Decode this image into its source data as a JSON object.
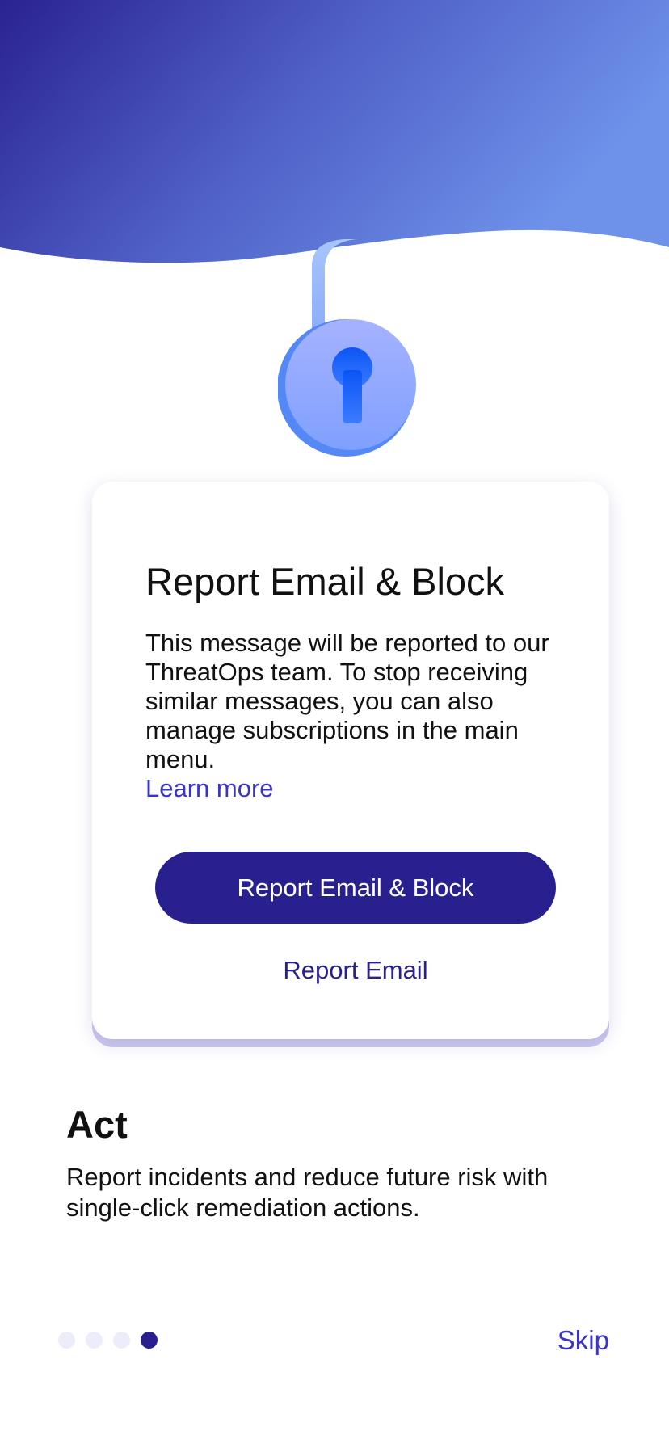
{
  "colors": {
    "accent": "#29208f",
    "link": "#3a34c8",
    "header_gradient_start": "#2a2290",
    "header_gradient_end": "#6e92ea",
    "dot_inactive": "#edecfb",
    "lock_body": "#8aa8ff",
    "keyhole": "#0a5cf5"
  },
  "illustration": {
    "icon": "padlock-icon"
  },
  "card": {
    "title": "Report Email & Block",
    "body": "This message will be reported to our ThreatOps team. To stop receiving similar messages, you can also manage subscriptions in the main menu.",
    "learn_more": "Learn more",
    "primary_button": "Report Email & Block",
    "secondary_button": "Report Email"
  },
  "section": {
    "title": "Act",
    "description": "Report incidents and reduce future risk with single-click remediation actions."
  },
  "pager": {
    "total": 4,
    "current": 4
  },
  "skip_label": "Skip"
}
